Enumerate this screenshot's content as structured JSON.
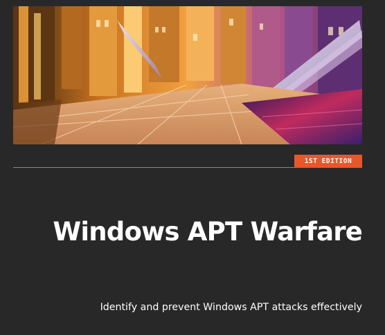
{
  "cover": {
    "image_description_icon": "city-arcade-photo",
    "edition_badge": "1ST EDITION",
    "title": "Windows APT Warfare",
    "subtitle": "Identify and prevent Windows APT attacks effectively"
  },
  "colors": {
    "background": "#282828",
    "badge": "#e8572a",
    "title_text": "#ffffff",
    "divider": "#8a8a8a"
  }
}
